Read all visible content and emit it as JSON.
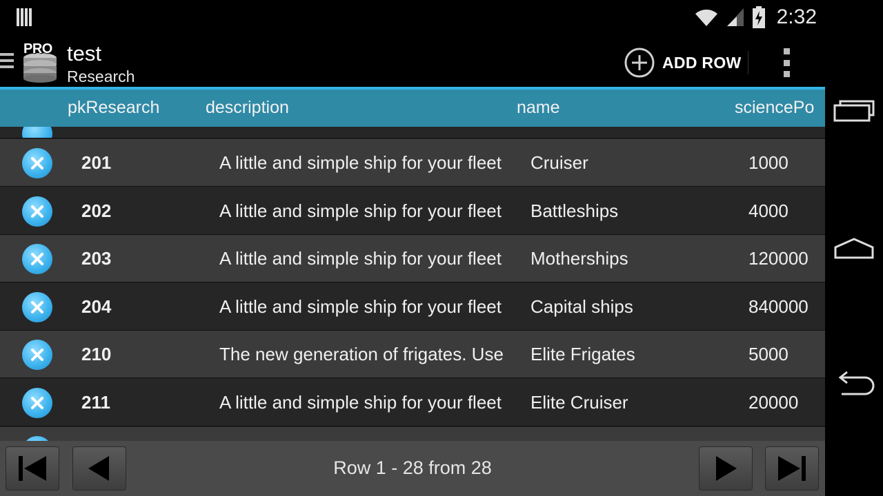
{
  "status_bar": {
    "time": "2:32"
  },
  "action_bar": {
    "logo_badge": "PRO",
    "title": "test",
    "subtitle": "Research",
    "add_row_label": "ADD ROW"
  },
  "table": {
    "columns": [
      "pkResearch",
      "description",
      "name",
      "sciencePo"
    ],
    "rows": [
      {
        "id": "201",
        "description": "A little and simple ship for your fleet",
        "name": "Cruiser",
        "sciencePoints": "1000"
      },
      {
        "id": "202",
        "description": "A little and simple ship for your fleet",
        "name": "Battleships",
        "sciencePoints": "4000"
      },
      {
        "id": "203",
        "description": "A little and simple ship for your fleet",
        "name": "Motherships",
        "sciencePoints": "120000"
      },
      {
        "id": "204",
        "description": "A little and simple ship for your fleet",
        "name": "Capital ships",
        "sciencePoints": "840000"
      },
      {
        "id": "210",
        "description": "The new generation of frigates. Use",
        "name": "Elite Frigates",
        "sciencePoints": "5000"
      },
      {
        "id": "211",
        "description": "A little and simple ship for your fleet",
        "name": "Elite Cruiser",
        "sciencePoints": "20000"
      }
    ]
  },
  "pager": {
    "label": "Row 1 - 28 from 28"
  },
  "colors": {
    "accent": "#33b5e5",
    "header_bg": "#2f8aa6",
    "delete_icon": "#3fb4ee"
  }
}
